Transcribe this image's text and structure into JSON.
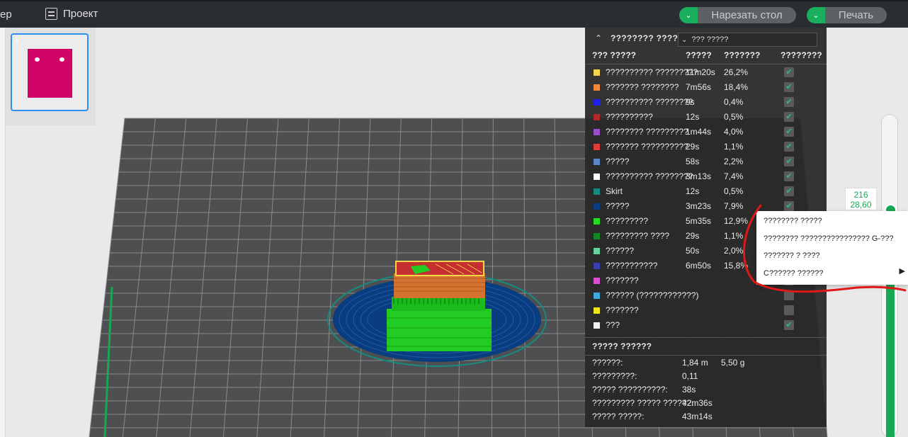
{
  "topbar": {
    "left_tab": "ер",
    "project_label": "Проект",
    "slice_label": "Нарезать стол",
    "print_label": "Печать",
    "colors": {
      "bar": "#2a2d31",
      "accent": "#1aaf5d"
    }
  },
  "plate": {
    "number": "1",
    "part_color": "#d10467"
  },
  "panel": {
    "title": "???????? ?????",
    "view_select": "??? ?????",
    "columns": {
      "type": "??? ?????",
      "time": "?????",
      "percent": "???????",
      "display": "????????"
    },
    "rows": [
      {
        "name": "?????????? ?????????",
        "time": "11m20s",
        "percent": "26,2%",
        "color": "#f5d64a",
        "checked": true
      },
      {
        "name": "??????? ????????",
        "time": "7m56s",
        "percent": "18,4%",
        "color": "#f08a3a",
        "checked": true
      },
      {
        "name": "?????????? ????????",
        "time": "9s",
        "percent": "0,4%",
        "color": "#2020ee",
        "checked": true
      },
      {
        "name": "??????????",
        "time": "12s",
        "percent": "0,5%",
        "color": "#b02a2a",
        "checked": true
      },
      {
        "name": "???????? ?????????",
        "time": "1m44s",
        "percent": "4,0%",
        "color": "#9b4cc9",
        "checked": true
      },
      {
        "name": "??????? ??????????",
        "time": "29s",
        "percent": "1,1%",
        "color": "#e23b3b",
        "checked": true
      },
      {
        "name": "?????",
        "time": "58s",
        "percent": "2,2%",
        "color": "#5b87c4",
        "checked": true
      },
      {
        "name": "?????????? ????????",
        "time": "3m13s",
        "percent": "7,4%",
        "color": "#ffffff",
        "checked": true
      },
      {
        "name": "Skirt",
        "time": "12s",
        "percent": "0,5%",
        "color": "#168a7e",
        "checked": true
      },
      {
        "name": "?????",
        "time": "3m23s",
        "percent": "7,9%",
        "color": "#0a3d80",
        "checked": true
      },
      {
        "name": "?????????",
        "time": "5m35s",
        "percent": "12,9%",
        "color": "#22dd22",
        "checked": true
      },
      {
        "name": "????????? ????",
        "time": "29s",
        "percent": "1,1%",
        "color": "#128a22",
        "checked": true
      },
      {
        "name": "??????",
        "time": "50s",
        "percent": "2,0%",
        "color": "#66d49a",
        "checked": true
      },
      {
        "name": "???????????",
        "time": "6m50s",
        "percent": "15,8%",
        "color": "#3a3fb0",
        "checked": true
      },
      {
        "name": "???????",
        "time": "",
        "percent": "",
        "color": "#d84fd0",
        "checked": false
      },
      {
        "name": "?????? (????????????)",
        "time": "",
        "percent": "",
        "color": "#3faadf",
        "checked": false
      },
      {
        "name": "???????",
        "time": "",
        "percent": "",
        "color": "#f2e61a",
        "checked": false
      },
      {
        "name": "???",
        "time": "",
        "percent": "",
        "color": "#f0f0f0",
        "checked": true
      }
    ],
    "summary_title": "????? ??????",
    "summary": [
      {
        "label": "??????:",
        "value": "1,84 m",
        "value2": "5,50 g"
      },
      {
        "label": "?????????:",
        "value": "0,11",
        "value2": ""
      },
      {
        "label": "????? ??????????:",
        "value": "38s",
        "value2": ""
      },
      {
        "label": "????????? ????? ??????:",
        "value": "42m36s",
        "value2": ""
      },
      {
        "label": "????? ?????:",
        "value": "43m14s",
        "value2": ""
      }
    ]
  },
  "layer_slider": {
    "layer": "216",
    "height": "28,60",
    "color": "#17a853"
  },
  "context_menu": {
    "items": [
      "???????? ?????",
      "???????? ???????????????? G-???",
      "??????? ? ????",
      "C?????? ??????"
    ]
  }
}
